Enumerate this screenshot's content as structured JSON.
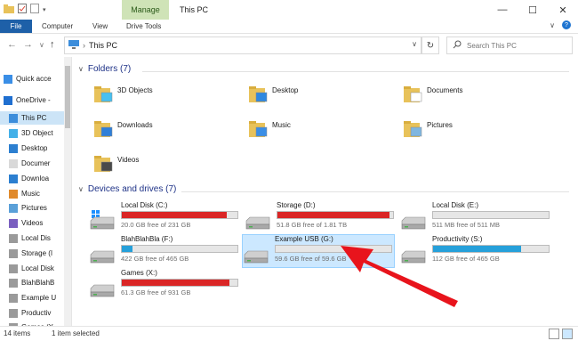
{
  "window": {
    "title": "This PC",
    "manage_tab": "Manage",
    "controls": [
      "minimize-icon",
      "maximize-icon",
      "close-icon"
    ]
  },
  "ribbon": {
    "tabs": [
      "File",
      "Computer",
      "View",
      "Drive Tools"
    ],
    "expand": "∨",
    "help": "?"
  },
  "address": {
    "path": "This PC",
    "search_placeholder": "Search This PC"
  },
  "nav": {
    "items": [
      {
        "label": "Quick acce",
        "icon": "star-icon"
      },
      {
        "label": "OneDrive -",
        "icon": "cloud-icon"
      },
      {
        "label": "This PC",
        "icon": "computer-icon"
      },
      {
        "label": "3D Object",
        "icon": "cube-icon"
      },
      {
        "label": "Desktop",
        "icon": "desktop-icon"
      },
      {
        "label": "Documer",
        "icon": "document-icon"
      },
      {
        "label": "Downloa",
        "icon": "download-icon"
      },
      {
        "label": "Music",
        "icon": "music-icon"
      },
      {
        "label": "Pictures",
        "icon": "picture-icon"
      },
      {
        "label": "Videos",
        "icon": "video-icon"
      },
      {
        "label": "Local Dis",
        "icon": "drive-icon"
      },
      {
        "label": "Storage (I",
        "icon": "drive-icon"
      },
      {
        "label": "Local Disk",
        "icon": "drive-icon"
      },
      {
        "label": "BlahBlahB",
        "icon": "drive-icon"
      },
      {
        "label": "Example U",
        "icon": "drive-icon"
      },
      {
        "label": "Productiv",
        "icon": "drive-icon"
      },
      {
        "label": "Games (X",
        "icon": "drive-icon"
      }
    ]
  },
  "folders": {
    "header": "Folders (7)",
    "items": [
      "3D Objects",
      "Desktop",
      "Documents",
      "Downloads",
      "Music",
      "Pictures",
      "Videos"
    ]
  },
  "drives": {
    "header": "Devices and drives (7)",
    "items": [
      {
        "name": "Local Disk (C:)",
        "free": "20.0 GB free of 231 GB",
        "used_fraction": 0.91,
        "color": "#da2626"
      },
      {
        "name": "Storage (D:)",
        "free": "51.8 GB free of 1.81 TB",
        "used_fraction": 0.97,
        "color": "#da2626"
      },
      {
        "name": "Local Disk (E:)",
        "free": "511 MB free of 511 MB",
        "used_fraction": 0.0,
        "color": "#26a0da"
      },
      {
        "name": "BlahBlahBla (F:)",
        "free": "422 GB free of 465 GB",
        "used_fraction": 0.09,
        "color": "#26a0da"
      },
      {
        "name": "Example USB (G:)",
        "free": "59.6 GB free of 59.6 GB",
        "used_fraction": 0.0,
        "color": "#26a0da"
      },
      {
        "name": "Productivity (S:)",
        "free": "112 GB free of 465 GB",
        "used_fraction": 0.76,
        "color": "#26a0da"
      },
      {
        "name": "Games (X:)",
        "free": "61.3 GB free of 931 GB",
        "used_fraction": 0.93,
        "color": "#da2626"
      }
    ]
  },
  "status": {
    "count": "14 items",
    "selected": "1 item selected"
  },
  "colors": {
    "accent": "#1e60a8",
    "selection": "#cce8ff",
    "bar_full": "#da2626",
    "bar_normal": "#26a0da",
    "annotation_arrow": "#e8141c"
  }
}
